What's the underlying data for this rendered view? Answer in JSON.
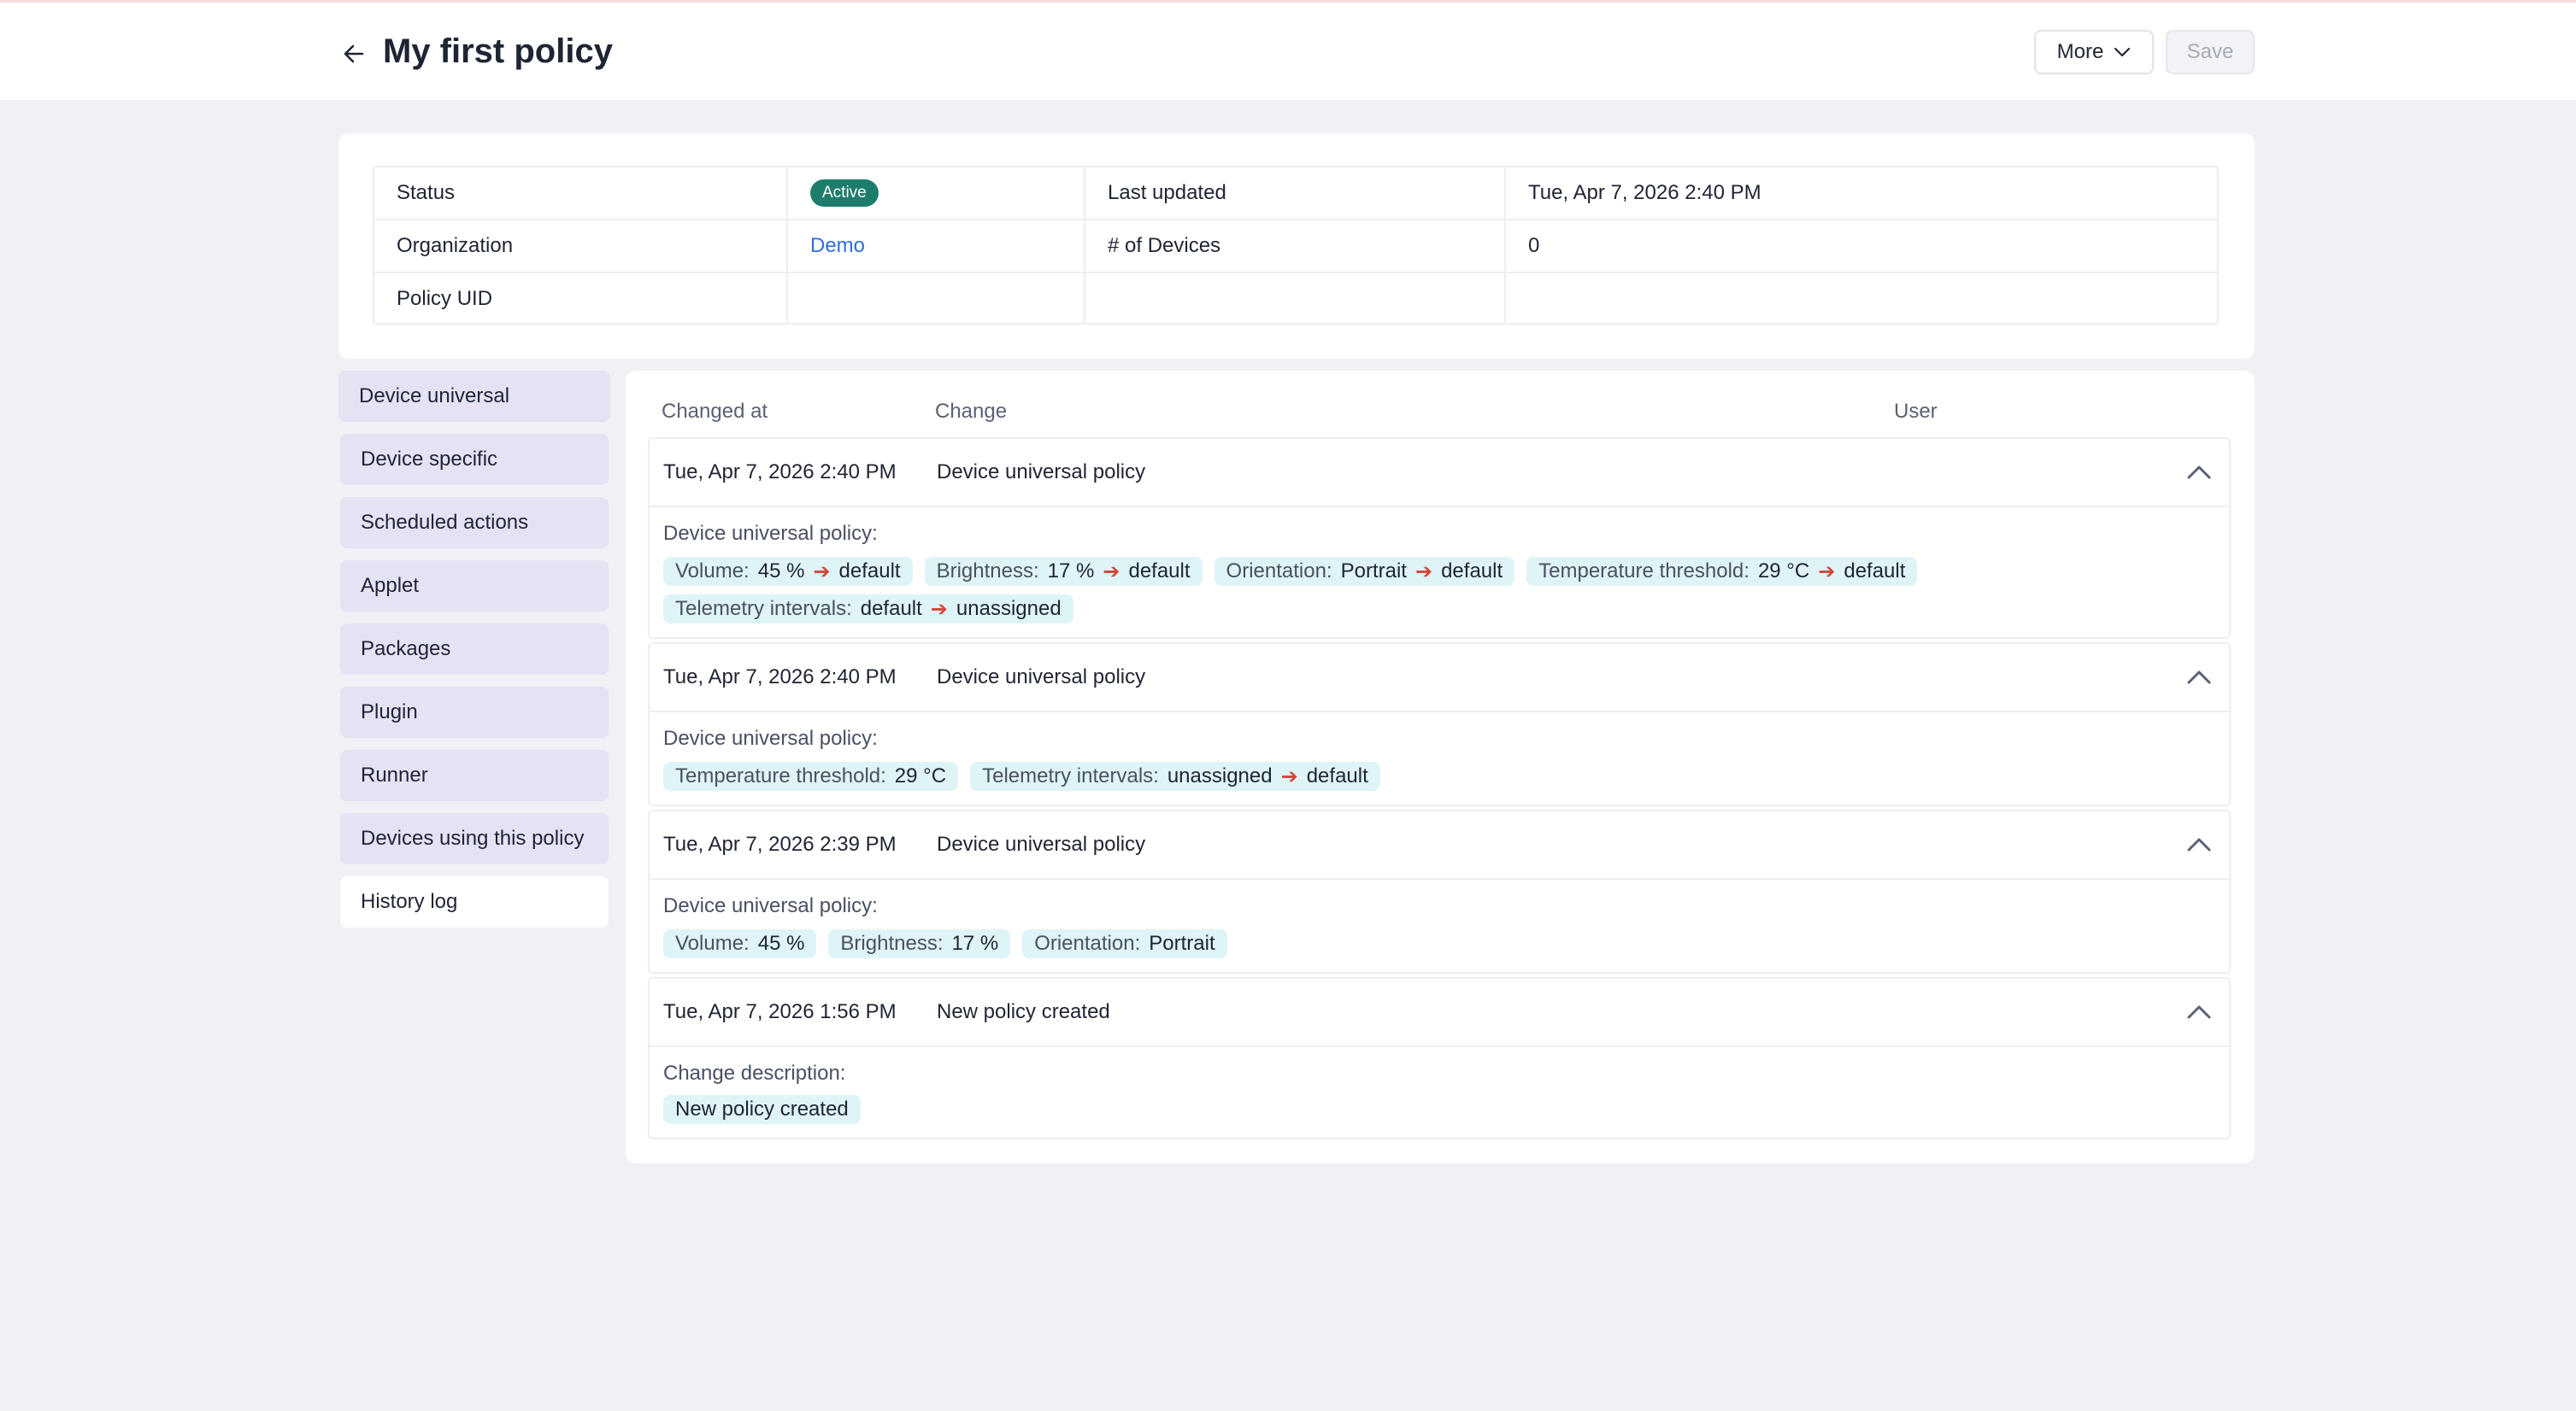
{
  "header": {
    "title": "My first policy",
    "more_label": "More",
    "save_label": "Save"
  },
  "colors": {
    "status_active": "#1d7d6d",
    "chip_bg": "#dff4f6",
    "arrow": "#d4463a",
    "sidebar_item_bg": "#e4e2f3",
    "link": "#2f6ed8"
  },
  "info": {
    "status_label": "Status",
    "status_value": "Active",
    "last_updated_label": "Last updated",
    "last_updated_value": "Tue, Apr 7, 2026 2:40 PM",
    "organization_label": "Organization",
    "organization_value": "Demo",
    "devices_label": "# of Devices",
    "devices_value": "0",
    "uid_label": "Policy UID"
  },
  "sidebar": {
    "items": [
      {
        "label": "Device universal"
      },
      {
        "label": "Device specific"
      },
      {
        "label": "Scheduled actions"
      },
      {
        "label": "Applet"
      },
      {
        "label": "Packages"
      },
      {
        "label": "Plugin"
      },
      {
        "label": "Runner"
      },
      {
        "label": "Devices using this policy"
      },
      {
        "label": "History log"
      }
    ]
  },
  "history": {
    "columns": {
      "changed_at": "Changed at",
      "change": "Change",
      "user": "User"
    },
    "entries": [
      {
        "date": "Tue, Apr 7, 2026 2:40 PM",
        "change": "Device universal policy",
        "body_label": "Device universal policy:",
        "row1": [
          {
            "key": "Volume:",
            "from": "45 %",
            "to": "default"
          },
          {
            "key": "Brightness:",
            "from": "17 %",
            "to": "default"
          },
          {
            "key": "Orientation:",
            "from": "Portrait",
            "to": "default"
          },
          {
            "key": "Temperature threshold:",
            "from": "29 °C",
            "to": "default"
          }
        ],
        "row2": [
          {
            "key": "Telemetry intervals:",
            "from": "default",
            "to": "unassigned"
          }
        ]
      },
      {
        "date": "Tue, Apr 7, 2026 2:40 PM",
        "change": "Device universal policy",
        "body_label": "Device universal policy:",
        "row1": [
          {
            "key": "Temperature threshold:",
            "value": "29 °C"
          },
          {
            "key": "Telemetry intervals:",
            "from": "unassigned",
            "to": "default"
          }
        ]
      },
      {
        "date": "Tue, Apr 7, 2026 2:39 PM",
        "change": "Device universal policy",
        "body_label": "Device universal policy:",
        "row1": [
          {
            "key": "Volume:",
            "value": "45 %"
          },
          {
            "key": "Brightness:",
            "value": "17 %"
          },
          {
            "key": "Orientation:",
            "value": "Portrait"
          }
        ]
      },
      {
        "date": "Tue, Apr 7, 2026 1:56 PM",
        "change": "New policy created",
        "body_label": "Change description:",
        "row1": [
          {
            "value": "New policy created"
          }
        ]
      }
    ],
    "arrow_glyph": "➔"
  }
}
